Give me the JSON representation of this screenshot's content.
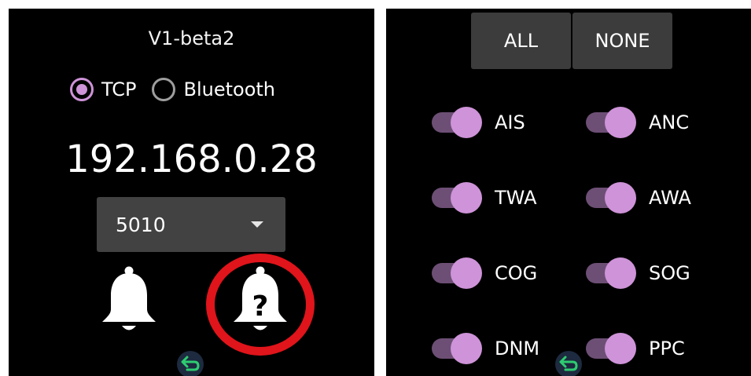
{
  "version": "V1-beta2",
  "connection": {
    "options": [
      {
        "label": "TCP",
        "selected": true
      },
      {
        "label": "Bluetooth",
        "selected": false
      }
    ]
  },
  "ip_address": "192.168.0.28",
  "port": {
    "value": "5010"
  },
  "icons": {
    "bell": "bell-icon",
    "bell_help": "bell-question-icon",
    "back": "back-arrow-icon"
  },
  "colors": {
    "accent": "#ce93d8",
    "track": "#6d4f75",
    "highlight_ring": "#e0141b",
    "back_arrow": "#2ecc71"
  },
  "filter": {
    "all_label": "ALL",
    "none_label": "NONE",
    "toggles": [
      {
        "label": "AIS",
        "on": true
      },
      {
        "label": "ANC",
        "on": true
      },
      {
        "label": "TWA",
        "on": true
      },
      {
        "label": "AWA",
        "on": true
      },
      {
        "label": "COG",
        "on": true
      },
      {
        "label": "SOG",
        "on": true
      },
      {
        "label": "DNM",
        "on": true
      },
      {
        "label": "PPC",
        "on": true
      }
    ]
  }
}
